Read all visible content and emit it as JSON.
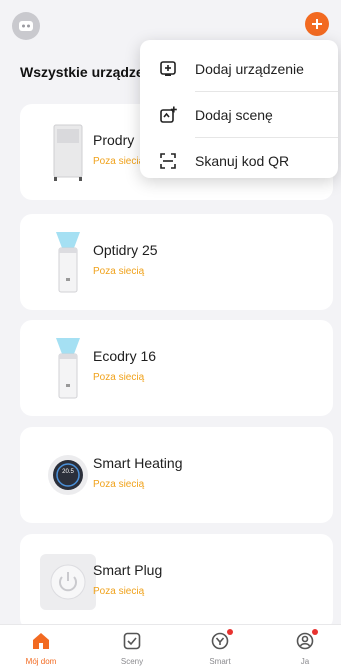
{
  "header": {
    "section_title": "Wszystkie urządzenia"
  },
  "menu": {
    "items": [
      {
        "label": "Dodaj urządzenie",
        "icon": "add-device-icon"
      },
      {
        "label": "Dodaj scenę",
        "icon": "add-scene-icon"
      },
      {
        "label": "Skanuj kod QR",
        "icon": "scan-qr-icon"
      }
    ]
  },
  "devices": [
    {
      "name": "Prodry",
      "status": "Poza siecią",
      "icon": "dehumidifier-icon"
    },
    {
      "name": "Optidry 25",
      "status": "Poza siecią",
      "icon": "dehumidifier-icon"
    },
    {
      "name": "Ecodry 16",
      "status": "Poza siecią",
      "icon": "dehumidifier-icon"
    },
    {
      "name": "Smart Heating",
      "status": "Poza siecią",
      "icon": "thermostat-icon",
      "display": "20.5"
    },
    {
      "name": "Smart Plug",
      "status": "Poza siecią",
      "icon": "plug-icon"
    }
  ],
  "tabs": [
    {
      "label": "Mój dom",
      "icon": "home-icon",
      "active": true
    },
    {
      "label": "Sceny",
      "icon": "scenes-icon",
      "active": false
    },
    {
      "label": "Smart",
      "icon": "smart-icon",
      "active": false,
      "badge": true
    },
    {
      "label": "Ja",
      "icon": "profile-icon",
      "active": false,
      "badge": true
    }
  ],
  "colors": {
    "accent": "#f26a21",
    "status_offline": "#f0a21b",
    "badge": "#e8322f"
  }
}
